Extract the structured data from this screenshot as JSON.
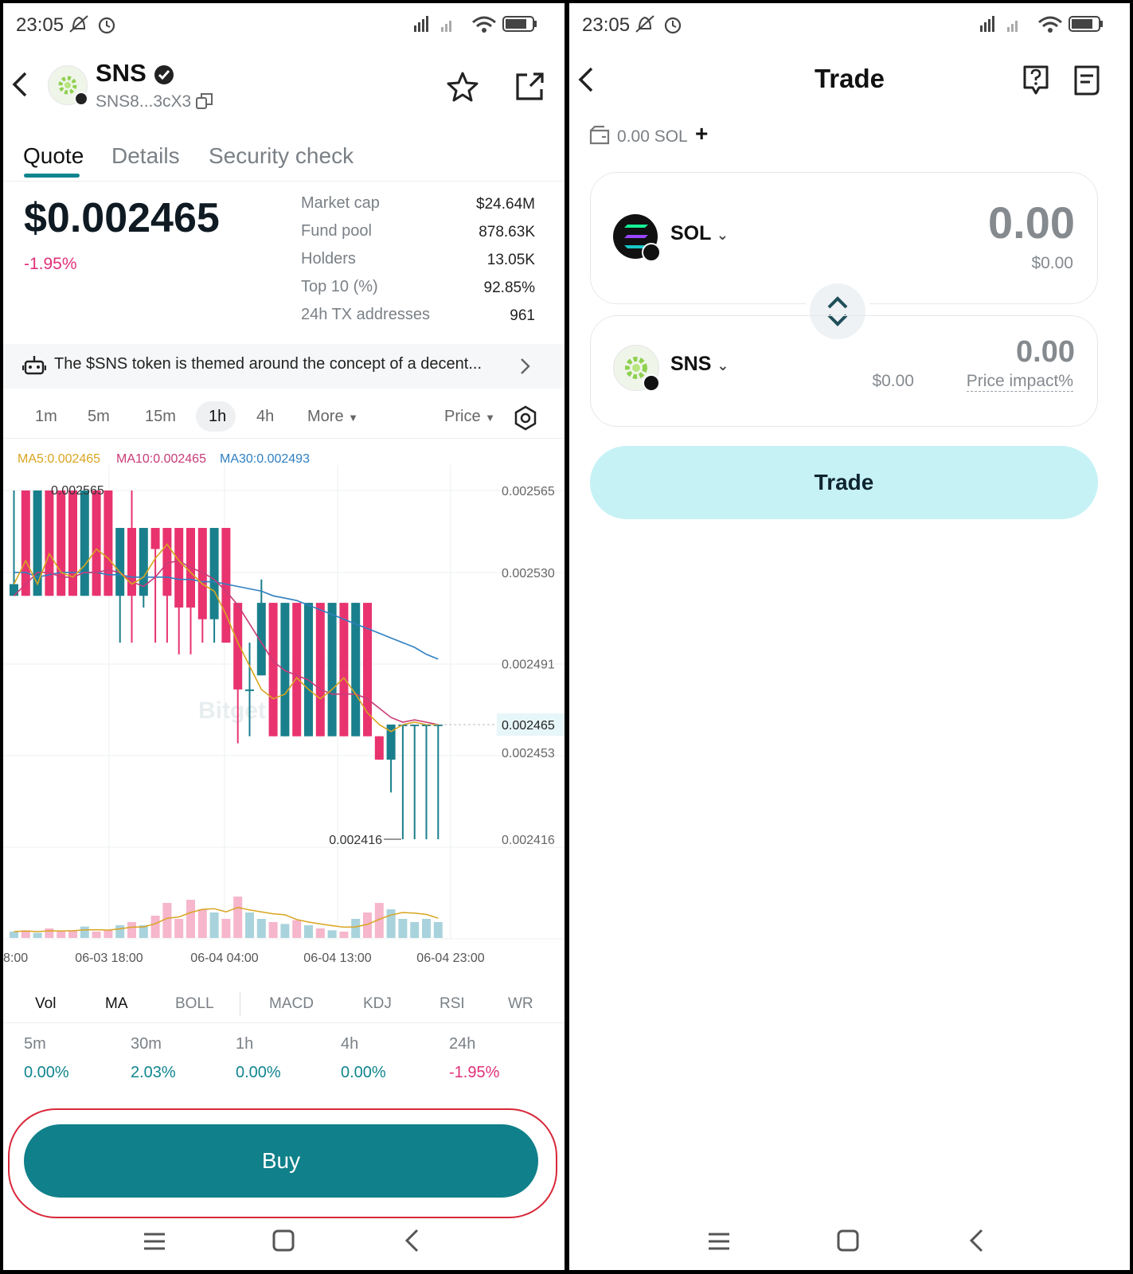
{
  "left": {
    "status": {
      "time": "23:05",
      "battery": "73"
    },
    "header": {
      "token_name": "SNS",
      "address": "SNS8...3cX3"
    },
    "tabs": [
      "Quote",
      "Details",
      "Security check"
    ],
    "price": {
      "value": "$0.002465",
      "change": "-1.95%"
    },
    "stats": [
      {
        "label": "Market cap",
        "value": "$24.64M"
      },
      {
        "label": "Fund pool",
        "value": "878.63K"
      },
      {
        "label": "Holders",
        "value": "13.05K"
      },
      {
        "label": "Top 10 (%)",
        "value": "92.85%"
      },
      {
        "label": "24h TX addresses",
        "value": "961"
      }
    ],
    "banner": {
      "text": "The $SNS token is themed around the concept of a decent..."
    },
    "timeframes": [
      "1m",
      "5m",
      "15m",
      "1h",
      "4h",
      "More"
    ],
    "price_selector": "Price",
    "ma_legend": {
      "ma5": "MA5:0.002465",
      "ma10": "MA10:0.002465",
      "ma30": "MA30:0.002493"
    },
    "chart_data": {
      "type": "candlestick",
      "y_tick_labels": [
        "0.002565",
        "0.002530",
        "0.002491",
        "0.002453",
        "0.002416"
      ],
      "current_price_label": "0.002465",
      "high_label": "0.002565",
      "low_label": "0.002416",
      "x_tick_labels": [
        "8:00",
        "06-03 18:00",
        "06-04 04:00",
        "06-04 13:00",
        "06-04 23:00"
      ],
      "watermark": "Bitget",
      "colors": {
        "up": "#1a7f8c",
        "down": "#e8336f",
        "ma5": "#d9a520",
        "ma10": "#c93b78",
        "ma30": "#2f7fc1"
      },
      "candles": [
        {
          "o": 0.00252,
          "c": 0.002525,
          "h": 0.002565,
          "l": 0.00252
        },
        {
          "o": 0.002565,
          "c": 0.00252,
          "h": 0.002565,
          "l": 0.00252
        },
        {
          "o": 0.00252,
          "c": 0.002565,
          "h": 0.002565,
          "l": 0.00252
        },
        {
          "o": 0.002565,
          "c": 0.00252,
          "h": 0.002565,
          "l": 0.00252
        },
        {
          "o": 0.002565,
          "c": 0.00252,
          "h": 0.002565,
          "l": 0.00252
        },
        {
          "o": 0.002565,
          "c": 0.00252,
          "h": 0.002565,
          "l": 0.00252
        },
        {
          "o": 0.00252,
          "c": 0.002565,
          "h": 0.002565,
          "l": 0.00252
        },
        {
          "o": 0.002565,
          "c": 0.00252,
          "h": 0.002565,
          "l": 0.00252
        },
        {
          "o": 0.002565,
          "c": 0.00252,
          "h": 0.002565,
          "l": 0.00252
        },
        {
          "o": 0.00252,
          "c": 0.002549,
          "h": 0.002549,
          "l": 0.0025
        },
        {
          "o": 0.002549,
          "c": 0.00252,
          "h": 0.002565,
          "l": 0.0025
        },
        {
          "o": 0.00252,
          "c": 0.002549,
          "h": 0.002549,
          "l": 0.002515
        },
        {
          "o": 0.002549,
          "c": 0.00254,
          "h": 0.002549,
          "l": 0.0025
        },
        {
          "o": 0.002549,
          "c": 0.00252,
          "h": 0.002549,
          "l": 0.0025
        },
        {
          "o": 0.002549,
          "c": 0.002515,
          "h": 0.002549,
          "l": 0.002495
        },
        {
          "o": 0.002549,
          "c": 0.002515,
          "h": 0.002549,
          "l": 0.002495
        },
        {
          "o": 0.002549,
          "c": 0.00251,
          "h": 0.002549,
          "l": 0.0025
        },
        {
          "o": 0.00251,
          "c": 0.002549,
          "h": 0.002549,
          "l": 0.0025
        },
        {
          "o": 0.002549,
          "c": 0.0025,
          "h": 0.002549,
          "l": 0.0025
        },
        {
          "o": 0.002517,
          "c": 0.00248,
          "h": 0.002517,
          "l": 0.002457
        },
        {
          "o": 0.00248,
          "c": 0.00248,
          "h": 0.0025,
          "l": 0.00246
        },
        {
          "o": 0.002486,
          "c": 0.002517,
          "h": 0.002527,
          "l": 0.002486
        },
        {
          "o": 0.002517,
          "c": 0.00246,
          "h": 0.002517,
          "l": 0.00246
        },
        {
          "o": 0.00246,
          "c": 0.002517,
          "h": 0.002517,
          "l": 0.00246
        },
        {
          "o": 0.002517,
          "c": 0.00246,
          "h": 0.002517,
          "l": 0.00246
        },
        {
          "o": 0.00246,
          "c": 0.002517,
          "h": 0.002517,
          "l": 0.00246
        },
        {
          "o": 0.002517,
          "c": 0.00246,
          "h": 0.002517,
          "l": 0.00246
        },
        {
          "o": 0.00246,
          "c": 0.002517,
          "h": 0.002517,
          "l": 0.00246
        },
        {
          "o": 0.002517,
          "c": 0.00246,
          "h": 0.002517,
          "l": 0.00246
        },
        {
          "o": 0.00246,
          "c": 0.002517,
          "h": 0.002517,
          "l": 0.00246
        },
        {
          "o": 0.002517,
          "c": 0.00246,
          "h": 0.002517,
          "l": 0.00246
        },
        {
          "o": 0.00246,
          "c": 0.00245,
          "h": 0.00246,
          "l": 0.00245
        },
        {
          "o": 0.00245,
          "c": 0.002465,
          "h": 0.002465,
          "l": 0.002436
        },
        {
          "o": 0.002465,
          "c": 0.002465,
          "h": 0.002465,
          "l": 0.002416
        },
        {
          "o": 0.002465,
          "c": 0.002465,
          "h": 0.002465,
          "l": 0.002416
        },
        {
          "o": 0.002465,
          "c": 0.002465,
          "h": 0.002465,
          "l": 0.002416
        },
        {
          "o": 0.002465,
          "c": 0.002465,
          "h": 0.002465,
          "l": 0.002416
        }
      ],
      "ma5": [
        0.002525,
        0.002535,
        0.002525,
        0.002538,
        0.00253,
        0.002528,
        0.002533,
        0.00254,
        0.002536,
        0.00253,
        0.002525,
        0.002528,
        0.002536,
        0.002542,
        0.002535,
        0.00253,
        0.002525,
        0.002522,
        0.002512,
        0.0025,
        0.00249,
        0.00248,
        0.002476,
        0.002478,
        0.002485,
        0.00248,
        0.002476,
        0.00248,
        0.002485,
        0.002478,
        0.00247,
        0.002465,
        0.002462,
        0.002465,
        0.002466,
        0.002465,
        0.002465
      ],
      "ma10": [
        0.00252,
        0.002525,
        0.00253,
        0.00253,
        0.002528,
        0.002528,
        0.00253,
        0.00253,
        0.002531,
        0.00253,
        0.002526,
        0.002524,
        0.002528,
        0.002534,
        0.002535,
        0.002532,
        0.00253,
        0.002527,
        0.002522,
        0.002516,
        0.002508,
        0.0025,
        0.002492,
        0.002488,
        0.002486,
        0.002484,
        0.00248,
        0.002478,
        0.002478,
        0.002478,
        0.002476,
        0.002472,
        0.002468,
        0.002466,
        0.002467,
        0.002466,
        0.002465
      ],
      "ma30": [
        0.00253,
        0.00253,
        0.002528,
        0.002529,
        0.00253,
        0.00253,
        0.00253,
        0.00253,
        0.002529,
        0.002529,
        0.002528,
        0.002528,
        0.002528,
        0.002528,
        0.002527,
        0.002527,
        0.002526,
        0.002526,
        0.002525,
        0.002524,
        0.002523,
        0.002522,
        0.00252,
        0.002519,
        0.002518,
        0.002516,
        0.002514,
        0.002512,
        0.00251,
        0.002508,
        0.002506,
        0.002504,
        0.002502,
        0.0025,
        0.002498,
        0.002495,
        0.002493
      ],
      "volume": [
        0.1,
        0.12,
        0.08,
        0.15,
        0.1,
        0.12,
        0.18,
        0.1,
        0.12,
        0.2,
        0.25,
        0.2,
        0.35,
        0.55,
        0.3,
        0.6,
        0.45,
        0.4,
        0.3,
        0.65,
        0.4,
        0.3,
        0.25,
        0.22,
        0.28,
        0.2,
        0.15,
        0.12,
        0.1,
        0.3,
        0.4,
        0.55,
        0.45,
        0.3,
        0.25,
        0.3,
        0.25
      ]
    },
    "indicators": [
      "Vol",
      "MA",
      "BOLL",
      "MACD",
      "KDJ",
      "RSI",
      "WR"
    ],
    "performance": [
      {
        "label": "5m",
        "value": "0.00%"
      },
      {
        "label": "30m",
        "value": "2.03%"
      },
      {
        "label": "1h",
        "value": "0.00%"
      },
      {
        "label": "4h",
        "value": "0.00%"
      },
      {
        "label": "24h",
        "value": "-1.95%"
      }
    ],
    "buy_button": "Buy"
  },
  "right": {
    "status": {
      "time": "23:05",
      "battery": "73"
    },
    "header": {
      "title": "Trade"
    },
    "balance": "0.00 SOL",
    "from": {
      "token": "SOL",
      "amount": "0.00",
      "usd": "$0.00"
    },
    "to": {
      "token": "SNS",
      "amount": "0.00",
      "usd": "$0.00",
      "impact_label": "Price impact%"
    },
    "trade_button": "Trade"
  }
}
